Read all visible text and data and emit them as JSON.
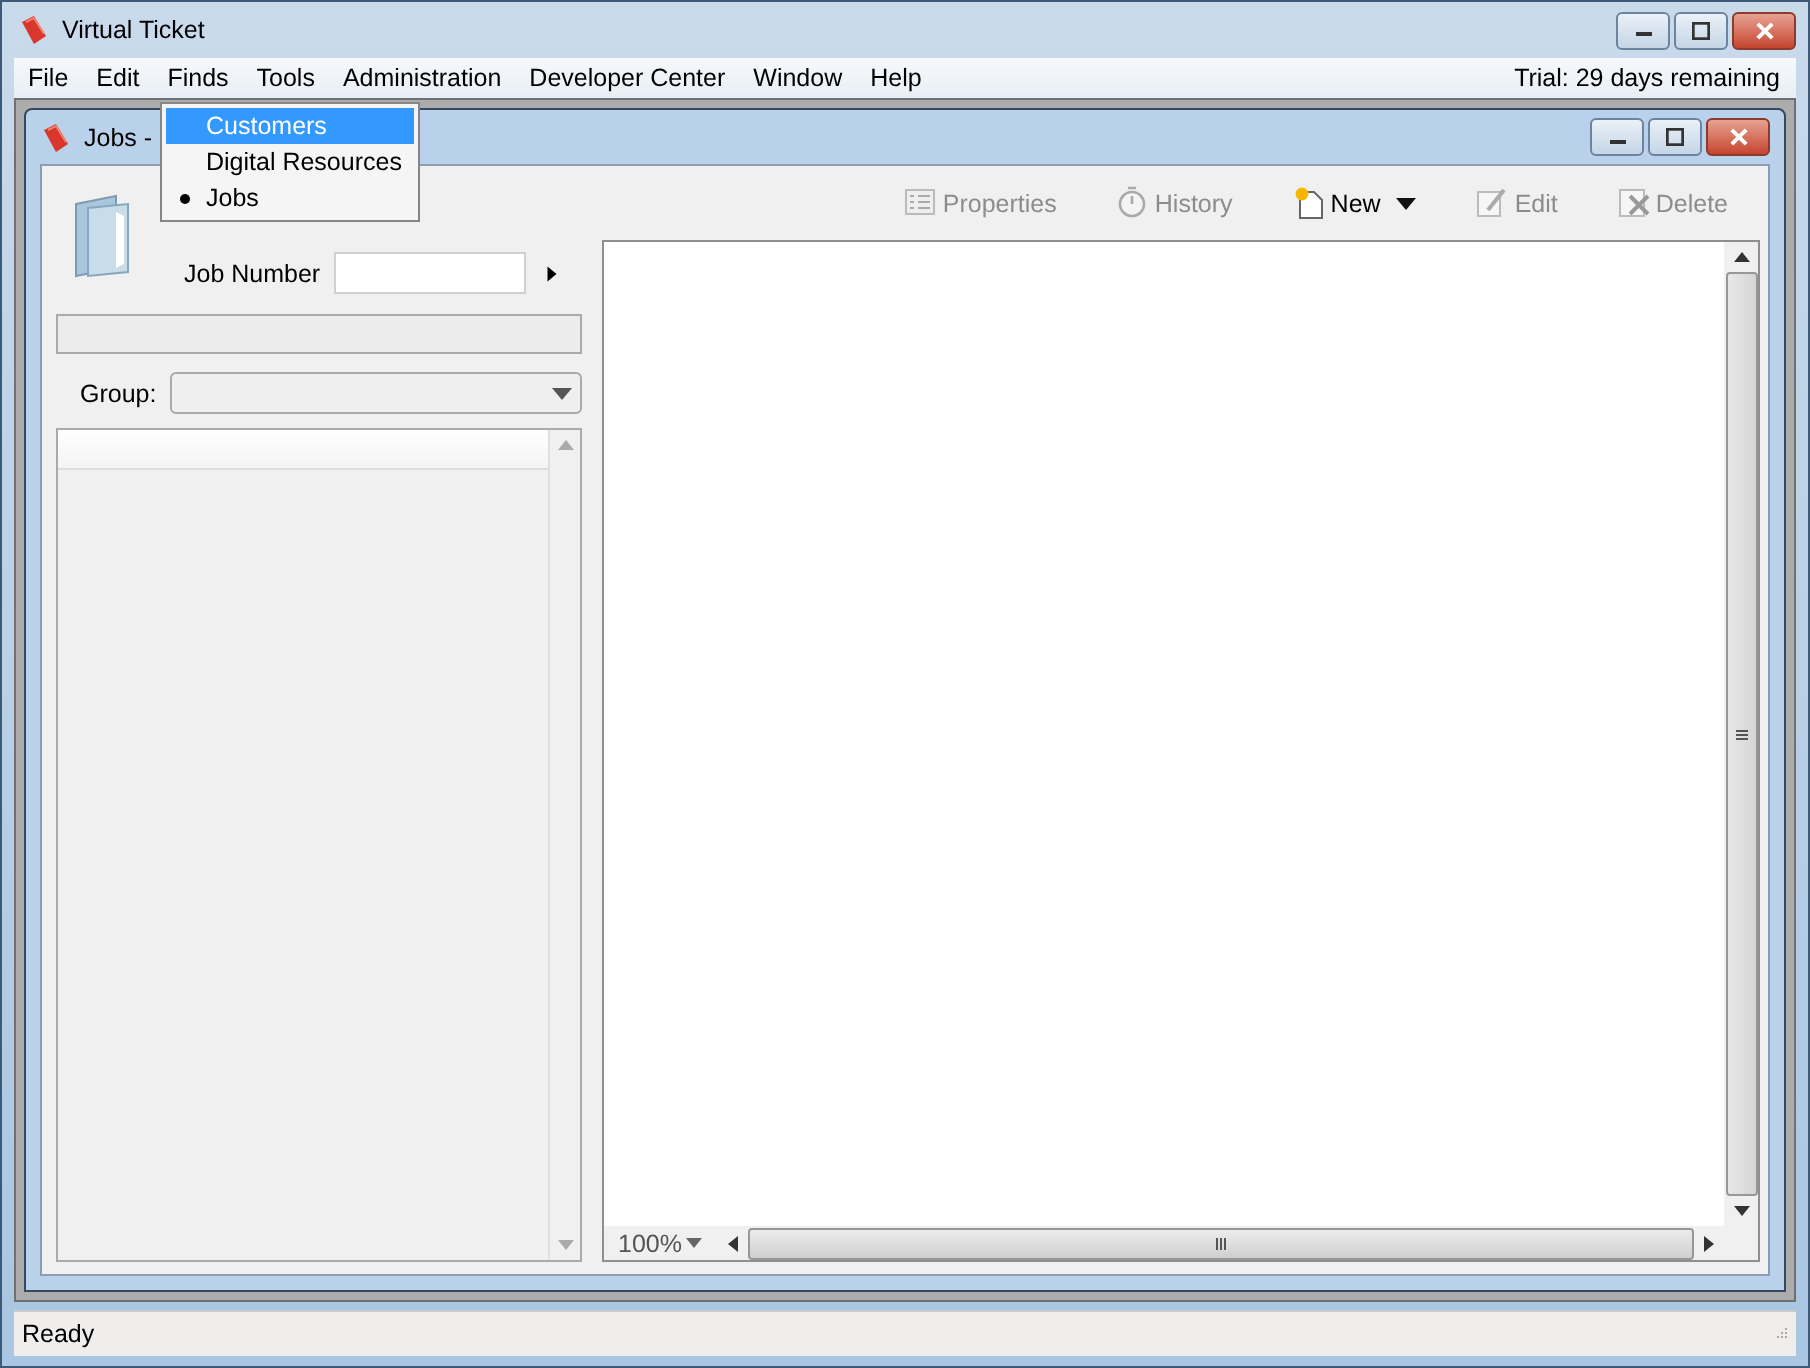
{
  "window": {
    "title": "Virtual Ticket"
  },
  "menu": [
    {
      "label": "File"
    },
    {
      "label": "Edit"
    },
    {
      "label": "Finds"
    },
    {
      "label": "Tools"
    },
    {
      "label": "Administration"
    },
    {
      "label": "Developer Center"
    },
    {
      "label": "Window"
    },
    {
      "label": "Help"
    }
  ],
  "trial_notice": "Trial: 29 days remaining",
  "finds_menu": [
    {
      "label": "Customers",
      "selected": true,
      "checked": false
    },
    {
      "label": "Digital Resources",
      "selected": false,
      "checked": false
    },
    {
      "label": "Jobs",
      "selected": false,
      "checked": true
    }
  ],
  "child_window": {
    "title": "Jobs -"
  },
  "toolbar": [
    {
      "label": "Properties",
      "kind": "properties",
      "disabled": true
    },
    {
      "label": "History",
      "kind": "history",
      "disabled": true
    },
    {
      "label": "New",
      "kind": "new",
      "disabled": false
    },
    {
      "label": "Edit",
      "kind": "edit",
      "disabled": true
    },
    {
      "label": "Delete",
      "kind": "delete",
      "disabled": true
    }
  ],
  "search": {
    "label": "Job Number"
  },
  "group": {
    "label": "Group:"
  },
  "zoom": "100%",
  "status_bar": "Ready"
}
